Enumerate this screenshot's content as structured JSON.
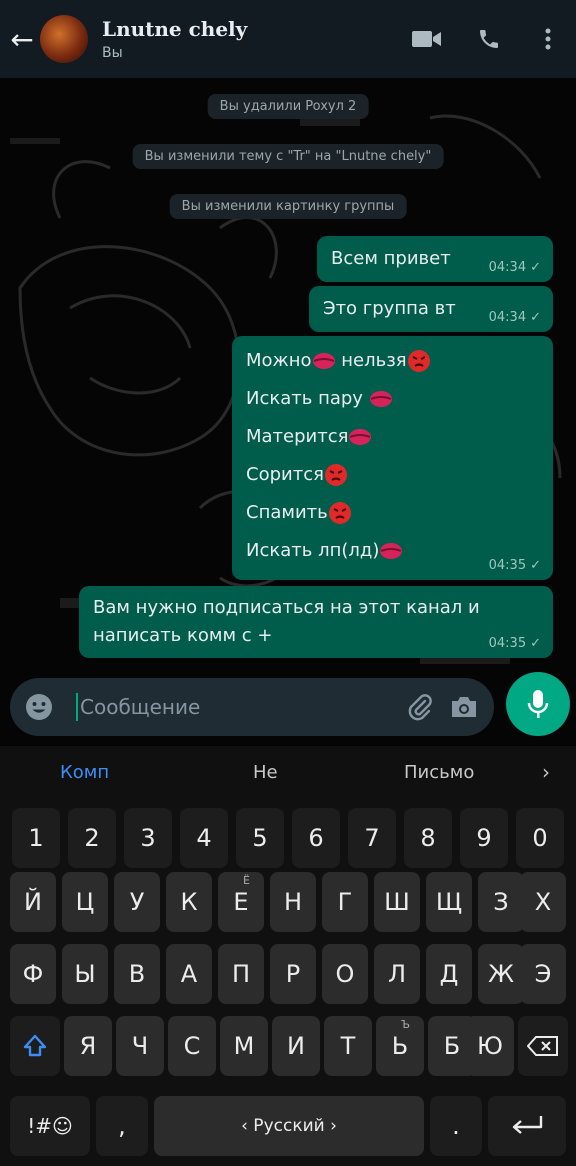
{
  "header": {
    "title": "Lnutne chely",
    "subtitle": "Вы",
    "icons": [
      "arrow-left-icon",
      "video-camera-icon",
      "phone-icon",
      "more-vertical-icon"
    ]
  },
  "system_messages": [
    "Вы удалили Poxyл 2",
    "Вы изменили тему с \"Tr\" на \"Lnutne chely\"",
    "Вы изменили картинку группы"
  ],
  "messages": [
    {
      "text": "Всем привет",
      "time": "04:34",
      "status": "✓"
    },
    {
      "text": "Это группа вт",
      "time": "04:34",
      "status": "✓"
    },
    {
      "lines": [
        {
          "text": "Можно",
          "emoji": [
            "kiss",
            "none"
          ],
          "text2": " нельзя",
          "emoji2": "angry"
        },
        {
          "text": "Искать пару ",
          "emoji": "kiss"
        },
        {
          "text": "Матерится",
          "emoji": "kiss"
        },
        {
          "text": "Сорится",
          "emoji": "angry"
        },
        {
          "text": "Спамить",
          "emoji": "angry"
        },
        {
          "text": "Искать лп(лд)",
          "emoji": "kiss"
        }
      ],
      "time": "04:35",
      "status": "✓"
    },
    {
      "line1": "Вам нужно подписаться на этот канал и",
      "line2": "написать комм с +",
      "time": "04:35",
      "status": "✓"
    }
  ],
  "input": {
    "placeholder": "Сообщение",
    "icons": [
      "emoji-icon",
      "paperclip-icon",
      "camera-icon",
      "microphone-icon"
    ]
  },
  "keyboard": {
    "suggestions": [
      "Комп",
      "Не",
      "Письмо"
    ],
    "suggestion_arrow": "›",
    "row_numbers": [
      "1",
      "2",
      "3",
      "4",
      "5",
      "6",
      "7",
      "8",
      "9",
      "0"
    ],
    "row1": [
      "Й",
      "Ц",
      "У",
      "К",
      "Е",
      "Н",
      "Г",
      "Ш",
      "Щ",
      "З",
      "Х"
    ],
    "row1_alt_e": "Ё",
    "row2": [
      "Ф",
      "Ы",
      "В",
      "А",
      "П",
      "Р",
      "О",
      "Л",
      "Д",
      "Ж",
      "Э"
    ],
    "row3": [
      "Я",
      "Ч",
      "С",
      "М",
      "И",
      "Т",
      "Ь",
      "Б",
      "Ю"
    ],
    "row3_alt_soft": "Ъ",
    "symbols_key": "!#☺",
    "comma": ",",
    "space_label": "‹ Русский ›",
    "period": ".",
    "enter_icon": "enter-icon",
    "shift_icon": "shift-icon",
    "backspace_icon": "backspace-icon"
  },
  "colors": {
    "header_bg": "#111b21",
    "bubble_out": "#005c4b",
    "accent": "#00a884",
    "suggest_active": "#3d8df5"
  }
}
